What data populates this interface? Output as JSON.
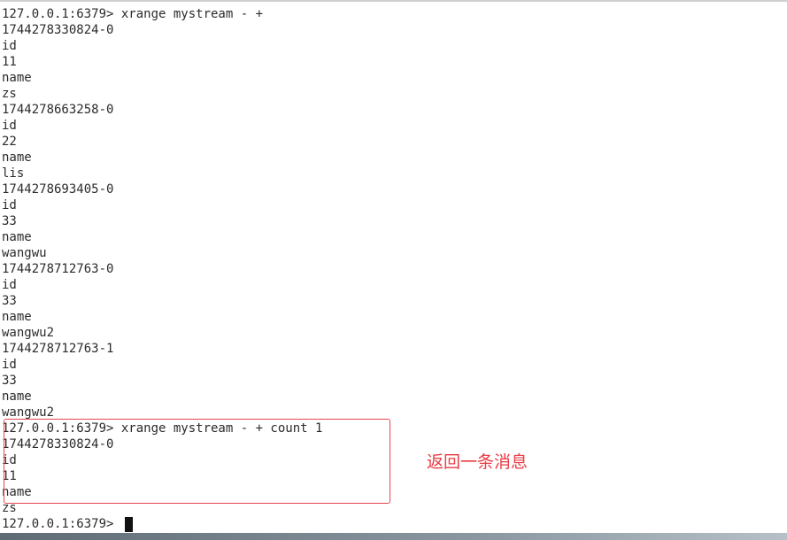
{
  "terminal": {
    "lines": [
      "127.0.0.1:6379> xrange mystream - +",
      "1744278330824-0",
      "id",
      "11",
      "name",
      "zs",
      "1744278663258-0",
      "id",
      "22",
      "name",
      "lis",
      "1744278693405-0",
      "id",
      "33",
      "name",
      "wangwu",
      "1744278712763-0",
      "id",
      "33",
      "name",
      "wangwu2",
      "1744278712763-1",
      "id",
      "33",
      "name",
      "wangwu2",
      "127.0.0.1:6379> xrange mystream - + count 1",
      "1744278330824-0",
      "id",
      "11",
      "name",
      "zs"
    ],
    "prompt": "127.0.0.1:6379> "
  },
  "annotation": {
    "text": "返回一条消息",
    "color": "#ea3b43"
  }
}
